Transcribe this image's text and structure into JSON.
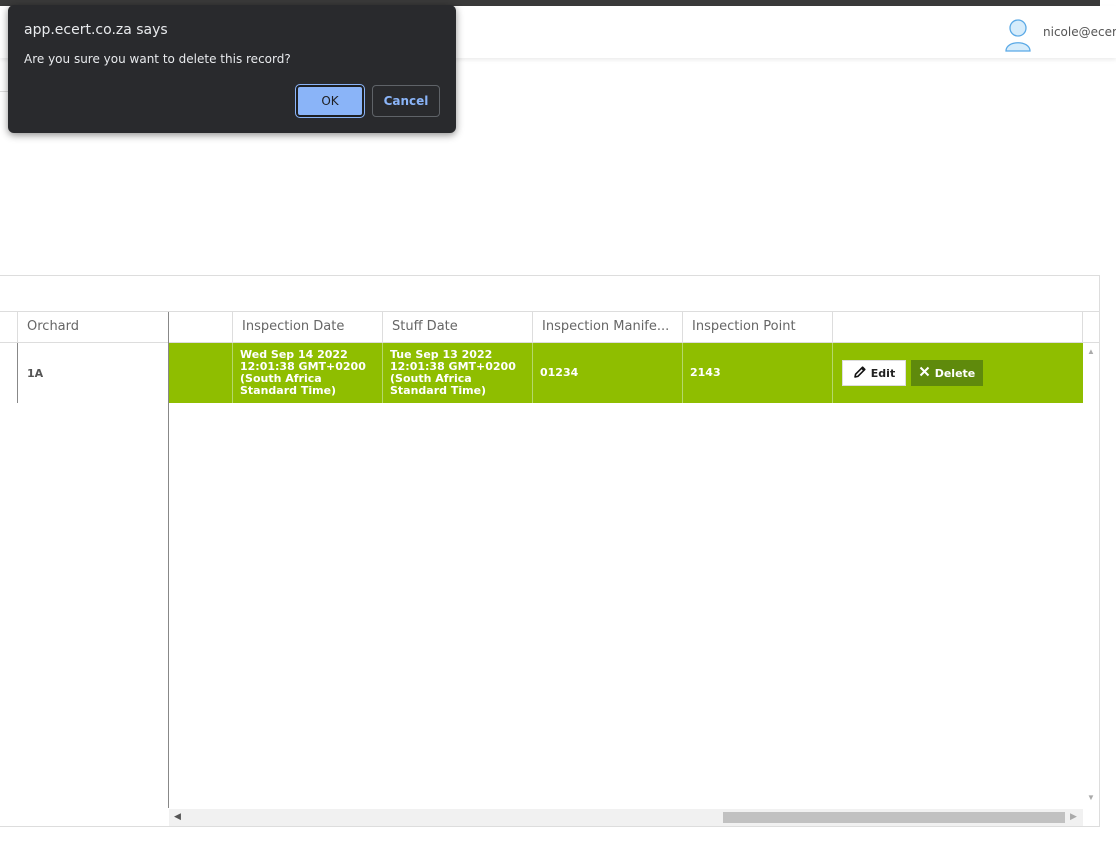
{
  "header": {
    "user_name": "nicole@ecert"
  },
  "dialog": {
    "title": "app.ecert.co.za says",
    "message": "Are you sure you want to delete this record?",
    "ok_label": "OK",
    "cancel_label": "Cancel"
  },
  "grid": {
    "columns": {
      "orchard": "Orchard",
      "blank": "",
      "inspection_date": "Inspection Date",
      "stuff_date": "Stuff Date",
      "inspection_manifest": "Inspection Manife...",
      "inspection_point": "Inspection Point",
      "actions": ""
    },
    "row": {
      "orchard": "1A",
      "inspection_date_lines": [
        "Wed Sep 14 2022",
        "12:01:38 GMT+0200",
        "(South Africa",
        "Standard Time)"
      ],
      "stuff_date_lines": [
        "Tue Sep 13 2022",
        "12:01:38 GMT+0200",
        "(South Africa",
        "Standard Time)"
      ],
      "inspection_manifest": "01234",
      "inspection_point": "2143",
      "edit_label": "Edit",
      "delete_label": "Delete"
    }
  },
  "colors": {
    "selected_row": "#8fbe00",
    "delete_button": "#5f8a0c",
    "dialog_bg": "#292a2d",
    "ok_button": "#8ab4f8"
  },
  "icons": {
    "user": "user-icon",
    "edit": "pencil-icon",
    "delete": "close-icon"
  }
}
